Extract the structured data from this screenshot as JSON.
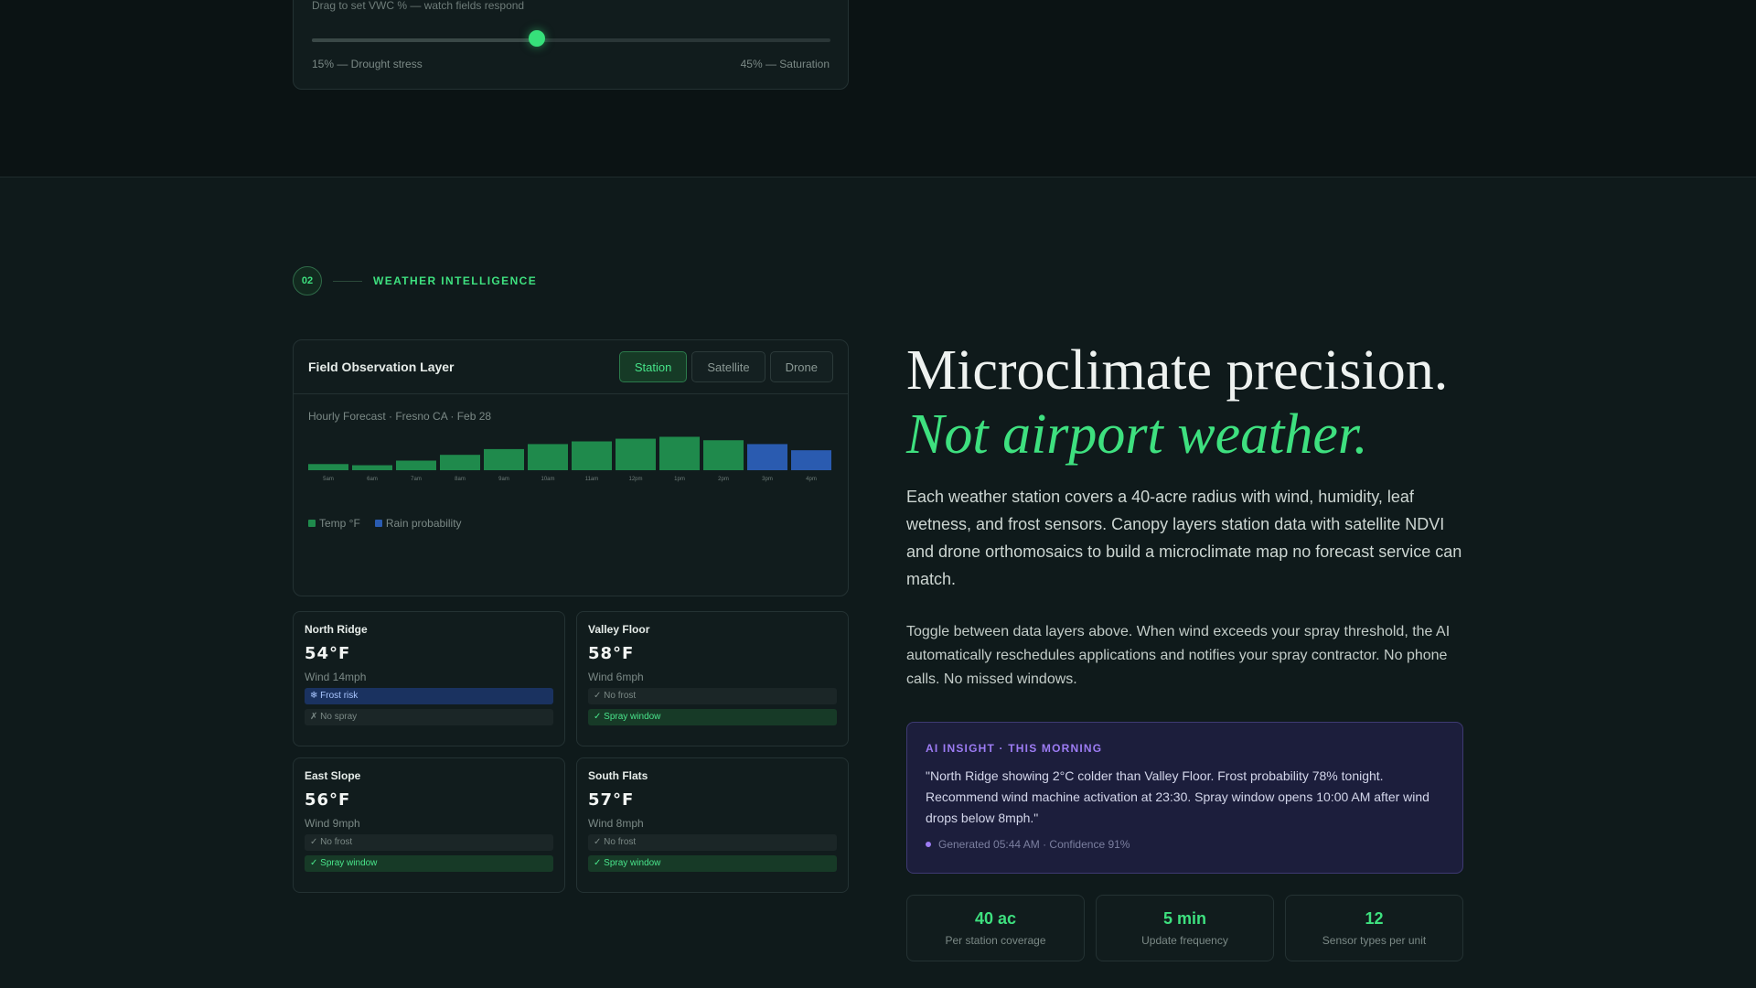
{
  "soil_slider": {
    "hint": "Drag to set VWC % — watch fields respond",
    "value_fraction": 0.433,
    "min_label": "15% — Drought stress",
    "max_label": "45% — Saturation"
  },
  "section": {
    "number": "02",
    "label": "WEATHER INTELLIGENCE"
  },
  "observation": {
    "title": "Field Observation Layer",
    "tabs": [
      {
        "label": "Station",
        "active": true
      },
      {
        "label": "Satellite",
        "active": false
      },
      {
        "label": "Drone",
        "active": false
      }
    ],
    "subtitle": "Hourly Forecast · Fresno CA · Feb 28",
    "legend": {
      "temp": "Temp °F",
      "rain": "Rain probability"
    },
    "colors": {
      "temp": "#1f8a4c",
      "rain": "#2a5bb0"
    }
  },
  "chart_data": {
    "type": "bar",
    "title": "",
    "categories": [
      "5am",
      "6am",
      "7am",
      "8am",
      "9am",
      "10am",
      "11am",
      "12pm",
      "1pm",
      "2pm",
      "3pm",
      "4pm"
    ],
    "values": [
      16,
      13,
      25,
      40,
      55,
      68,
      75,
      82,
      87,
      78,
      68,
      52
    ],
    "series_by_bar": [
      "Temp °F",
      "Temp °F",
      "Temp °F",
      "Temp °F",
      "Temp °F",
      "Temp °F",
      "Temp °F",
      "Temp °F",
      "Temp °F",
      "Temp °F",
      "Rain probability",
      "Rain probability"
    ],
    "ylim": [
      0,
      100
    ],
    "grid": false,
    "legend_position": "bottom-left"
  },
  "zones": [
    {
      "name": "North Ridge",
      "temp": "54°F",
      "wind": "Wind 14mph",
      "pills": [
        {
          "text": "❄ Frost risk",
          "kind": "frost"
        },
        {
          "text": "✗ No spray",
          "kind": "muted"
        }
      ]
    },
    {
      "name": "Valley Floor",
      "temp": "58°F",
      "wind": "Wind 6mph",
      "pills": [
        {
          "text": "✓ No frost",
          "kind": "muted"
        },
        {
          "text": "✓ Spray window",
          "kind": "go"
        }
      ]
    },
    {
      "name": "East Slope",
      "temp": "56°F",
      "wind": "Wind 9mph",
      "pills": [
        {
          "text": "✓ No frost",
          "kind": "muted"
        },
        {
          "text": "✓ Spray window",
          "kind": "go"
        }
      ]
    },
    {
      "name": "South Flats",
      "temp": "57°F",
      "wind": "Wind 8mph",
      "pills": [
        {
          "text": "✓ No frost",
          "kind": "muted"
        },
        {
          "text": "✓ Spray window",
          "kind": "go"
        }
      ]
    }
  ],
  "hero": {
    "line1": "Microclimate precision.",
    "line2": "Not airport weather.",
    "para1": "Each weather station covers a 40-acre radius with wind, humidity, leaf wetness, and frost sensors. Canopy layers station data with satellite NDVI and drone orthomosaics to build a microclimate map no forecast service can match.",
    "para2": "Toggle between data layers above. When wind exceeds your spray threshold, the AI automatically reschedules applications and notifies your spray contractor. No phone calls. No missed windows."
  },
  "ai_insight": {
    "label": "AI INSIGHT · THIS MORNING",
    "quote": "\"North Ridge showing 2°C colder than Valley Floor. Frost probability 78% tonight. Recommend wind machine activation at 23:30. Spray window opens 10:00 AM after wind drops below 8mph.\"",
    "meta": "Generated 05:44 AM · Confidence 91%"
  },
  "stats": [
    {
      "value": "40 ac",
      "label": "Per station coverage"
    },
    {
      "value": "5 min",
      "label": "Update frequency"
    },
    {
      "value": "12",
      "label": "Sensor types per unit"
    }
  ]
}
